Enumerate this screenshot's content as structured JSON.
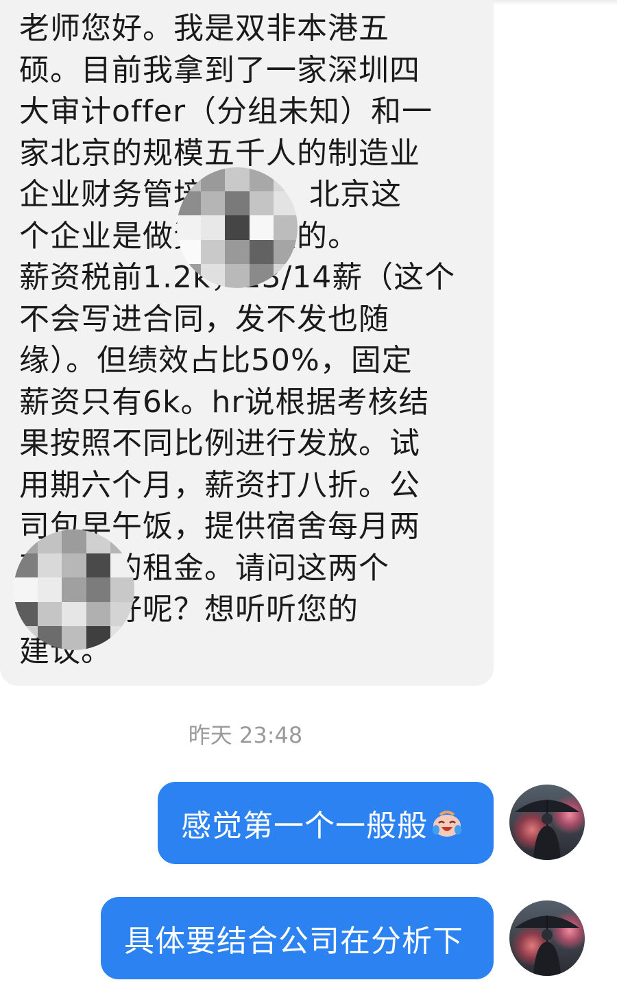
{
  "incoming_message": {
    "text": "老师您好。我是双非本港五\n硕。目前我拿到了一家深圳四\n大审计offer（分组未知）和一\n家北京的规模五千人的制造业\n企业财务管培offer。北京这\n个企业是做资源回收的。\n薪资税前1.2k，13/14薪（这个\n不会写进合同，发不发也随\n缘）。但绩效占比50%，固定\n薪资只有6k。hr说根据考核结\n果按照不同比例进行发放。试\n用期六个月，薪资打八折。公\n司包早午饭，提供宿舍每月两\n百块钱的租金。请问这两个\n哪个更好呢？想听听您的\n建议。"
  },
  "timestamp": "昨天 23:48",
  "outgoing_messages": [
    {
      "text": "感觉第一个一般般",
      "emoji": "crying-laughing-face-icon"
    },
    {
      "text": "具体要结合公司在分析下"
    }
  ],
  "colors": {
    "incoming_bg": "#f2f2f2",
    "outgoing_bg": "#2d82f2",
    "timestamp": "#9a9a9a"
  }
}
